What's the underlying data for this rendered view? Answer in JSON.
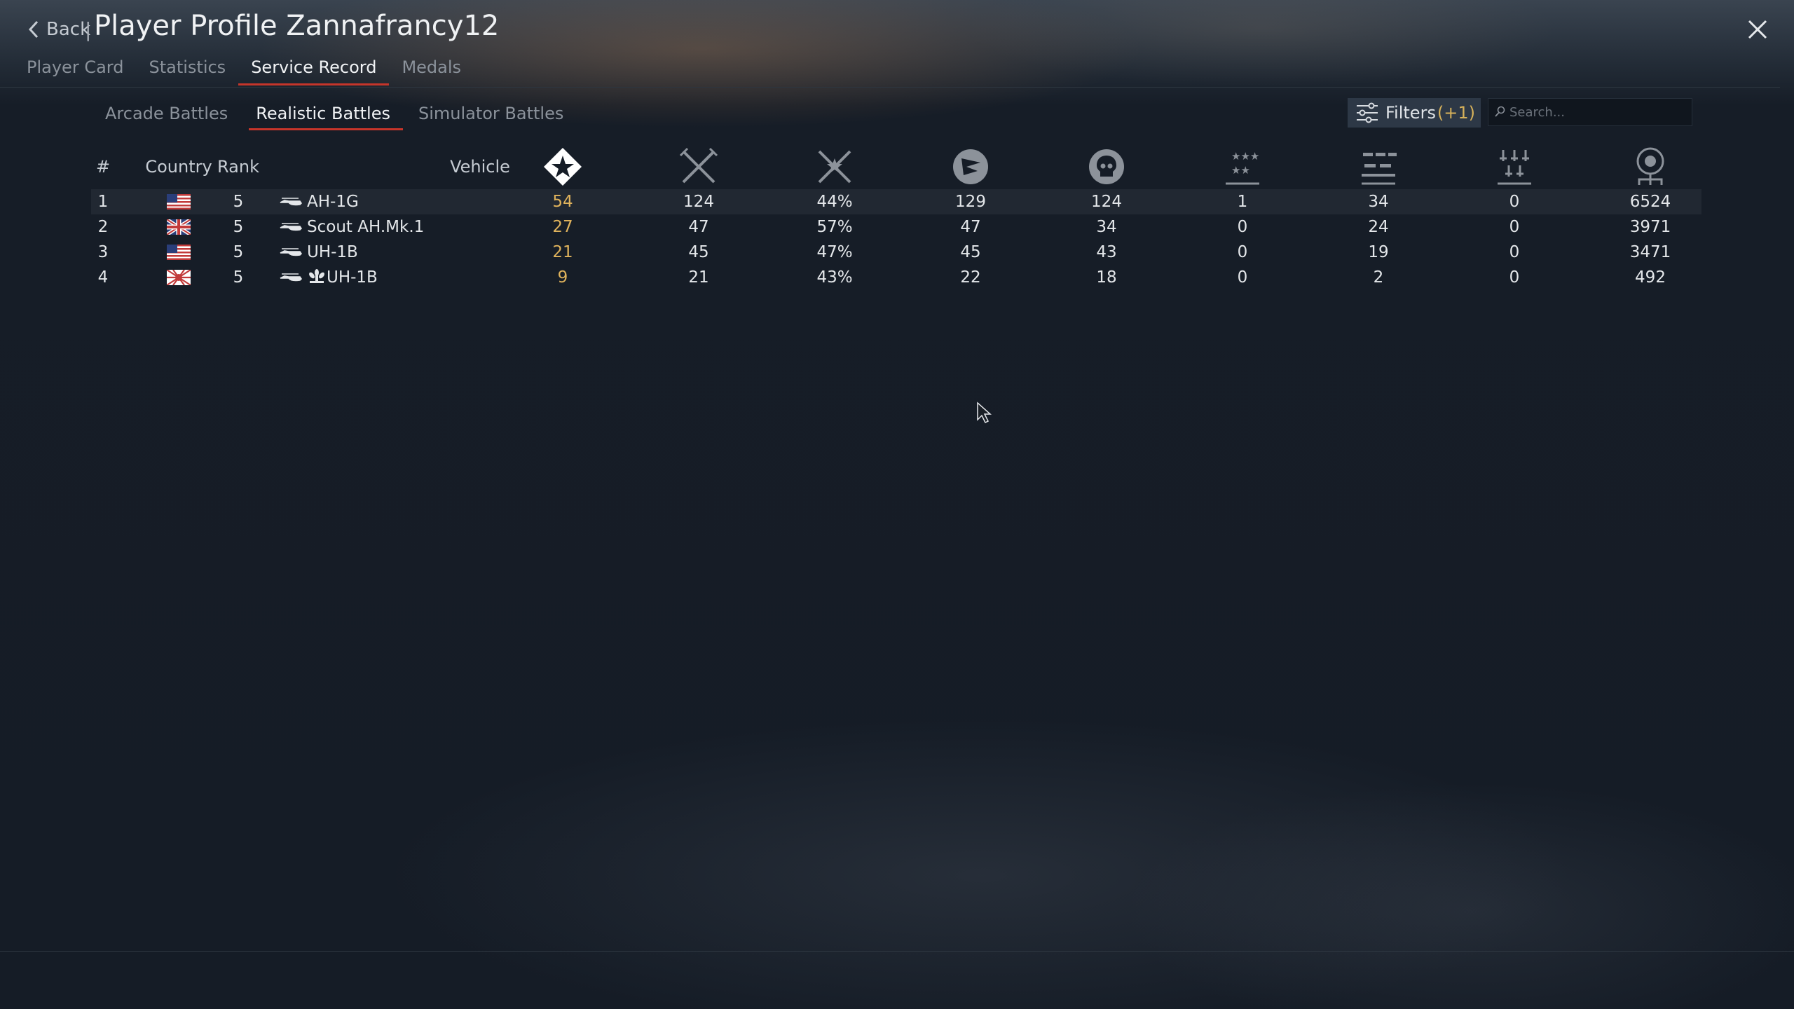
{
  "header": {
    "back_label": "Back",
    "separator": "|",
    "title": "Player Profile Zannafrancy12"
  },
  "tabs": [
    {
      "label": "Player Card"
    },
    {
      "label": "Statistics"
    },
    {
      "label": "Service Record",
      "active": true
    },
    {
      "label": "Medals"
    }
  ],
  "mode_tabs": [
    {
      "label": "Arcade Battles"
    },
    {
      "label": "Realistic Battles",
      "active": true
    },
    {
      "label": "Simulator Battles"
    }
  ],
  "filters": {
    "label": "Filters",
    "count": "(+1)"
  },
  "search": {
    "placeholder": "Search..."
  },
  "columns": {
    "num": "#",
    "country": "Country",
    "rank": "Rank",
    "vehicle": "Vehicle",
    "icons": [
      "victories-icon",
      "battles-icon",
      "win-rate-icon",
      "respawns-icon",
      "deaths-icon",
      "air-targets-destroyed-icon",
      "ground-targets-destroyed-icon",
      "naval-targets-destroyed-icon",
      "score-icon"
    ]
  },
  "rows": [
    {
      "num": "1",
      "country": "usa-flag",
      "rank": "5",
      "vehicle": "AH-1G",
      "vehicle_icon": "helicopter-icon",
      "victories": "54",
      "battles": "124",
      "win_rate": "44%",
      "respawns": "129",
      "deaths": "124",
      "air_kills": "1",
      "ground_kills": "34",
      "naval_kills": "0",
      "score": "6524"
    },
    {
      "num": "2",
      "country": "uk-flag",
      "rank": "5",
      "vehicle": "Scout AH.Mk.1",
      "vehicle_icon": "helicopter-icon",
      "victories": "27",
      "battles": "47",
      "win_rate": "57%",
      "respawns": "47",
      "deaths": "34",
      "air_kills": "0",
      "ground_kills": "24",
      "naval_kills": "0",
      "score": "3971"
    },
    {
      "num": "3",
      "country": "usa-flag",
      "rank": "5",
      "vehicle": "UH-1B",
      "vehicle_icon": "helicopter-icon",
      "victories": "21",
      "battles": "45",
      "win_rate": "47%",
      "respawns": "45",
      "deaths": "43",
      "air_kills": "0",
      "ground_kills": "19",
      "naval_kills": "0",
      "score": "3471"
    },
    {
      "num": "4",
      "country": "japan-flag",
      "rank": "5",
      "vehicle": "UH-1B",
      "vehicle_prefix_icon": "chrysanthemum-icon",
      "vehicle_icon": "helicopter-icon",
      "victories": "9",
      "battles": "21",
      "win_rate": "43%",
      "respawns": "22",
      "deaths": "18",
      "air_kills": "0",
      "ground_kills": "2",
      "naval_kills": "0",
      "score": "492"
    }
  ],
  "colors": {
    "accent_red": "#c6352a",
    "gold": "#e0b35c",
    "background": "#151c26"
  }
}
